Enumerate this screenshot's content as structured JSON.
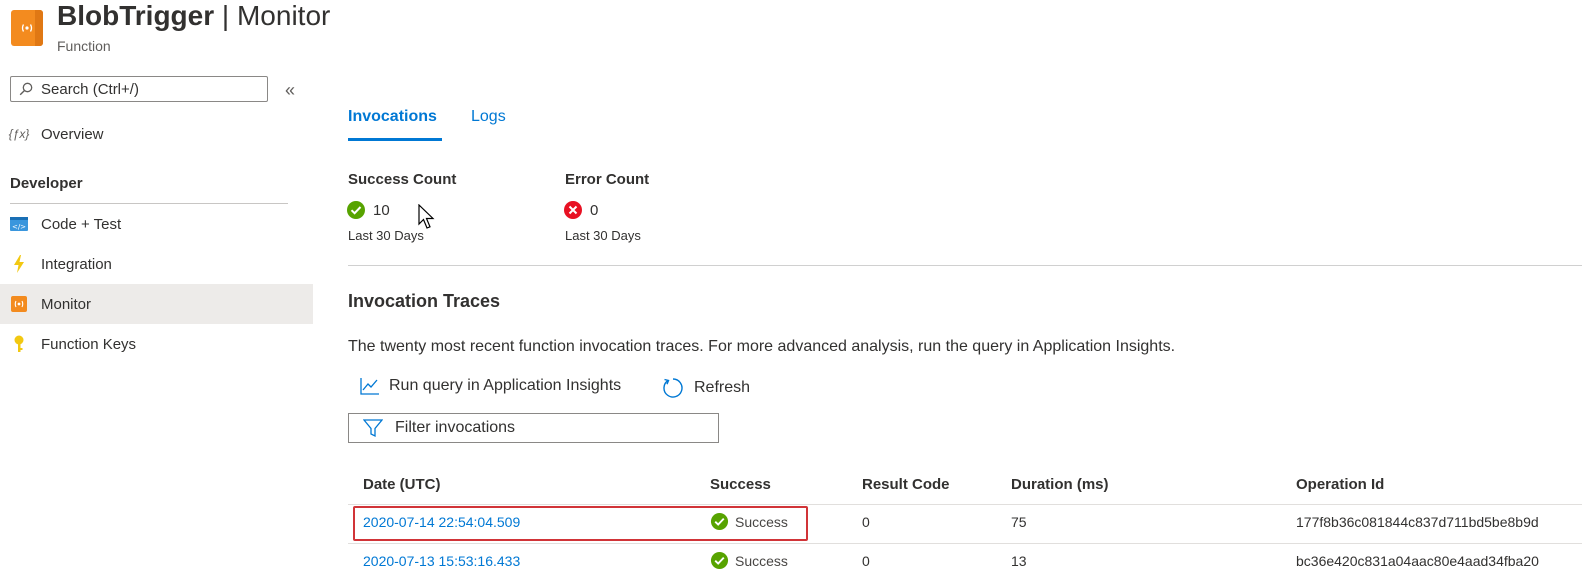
{
  "header": {
    "title_main": "BlobTrigger",
    "title_sep": " | ",
    "title_rest": "Monitor",
    "subtitle": "Function",
    "icon": "function-app-icon"
  },
  "sidebar": {
    "search_placeholder": "Search (Ctrl+/)",
    "collapse": "«",
    "overview_label": "Overview",
    "section_developer": "Developer",
    "items": [
      {
        "label": "Code + Test",
        "icon": "code-icon"
      },
      {
        "label": "Integration",
        "icon": "lightning-icon"
      },
      {
        "label": "Monitor",
        "icon": "monitor-icon",
        "active": true
      },
      {
        "label": "Function Keys",
        "icon": "key-icon"
      }
    ]
  },
  "tabs": {
    "invocations": "Invocations",
    "logs": "Logs"
  },
  "stats": {
    "success": {
      "label": "Success Count",
      "value": "10",
      "sub": "Last 30 Days"
    },
    "error": {
      "label": "Error Count",
      "value": "0",
      "sub": "Last 30 Days"
    }
  },
  "traces": {
    "title": "Invocation Traces",
    "description": "The twenty most recent function invocation traces. For more advanced analysis, run the query in Application Insights.",
    "run_query": "Run query in Application Insights",
    "refresh": "Refresh",
    "filter_placeholder": "Filter invocations"
  },
  "table": {
    "headers": {
      "date": "Date (UTC)",
      "success": "Success",
      "result_code": "Result Code",
      "duration": "Duration (ms)",
      "operation_id": "Operation Id"
    },
    "rows": [
      {
        "date": "2020-07-14 22:54:04.509",
        "success": "Success",
        "result_code": "0",
        "duration": "75",
        "operation_id": "177f8b36c081844c837d711bd5be8b9d"
      },
      {
        "date": "2020-07-13 15:53:16.433",
        "success": "Success",
        "result_code": "0",
        "duration": "13",
        "operation_id": "bc36e420c831a04aac80e4aad34fba20"
      }
    ]
  },
  "colors": {
    "accent": "#0078d4",
    "success": "#57a300",
    "error": "#e81123",
    "highlight": "#d13438",
    "function_orange": "#f38b1f"
  }
}
